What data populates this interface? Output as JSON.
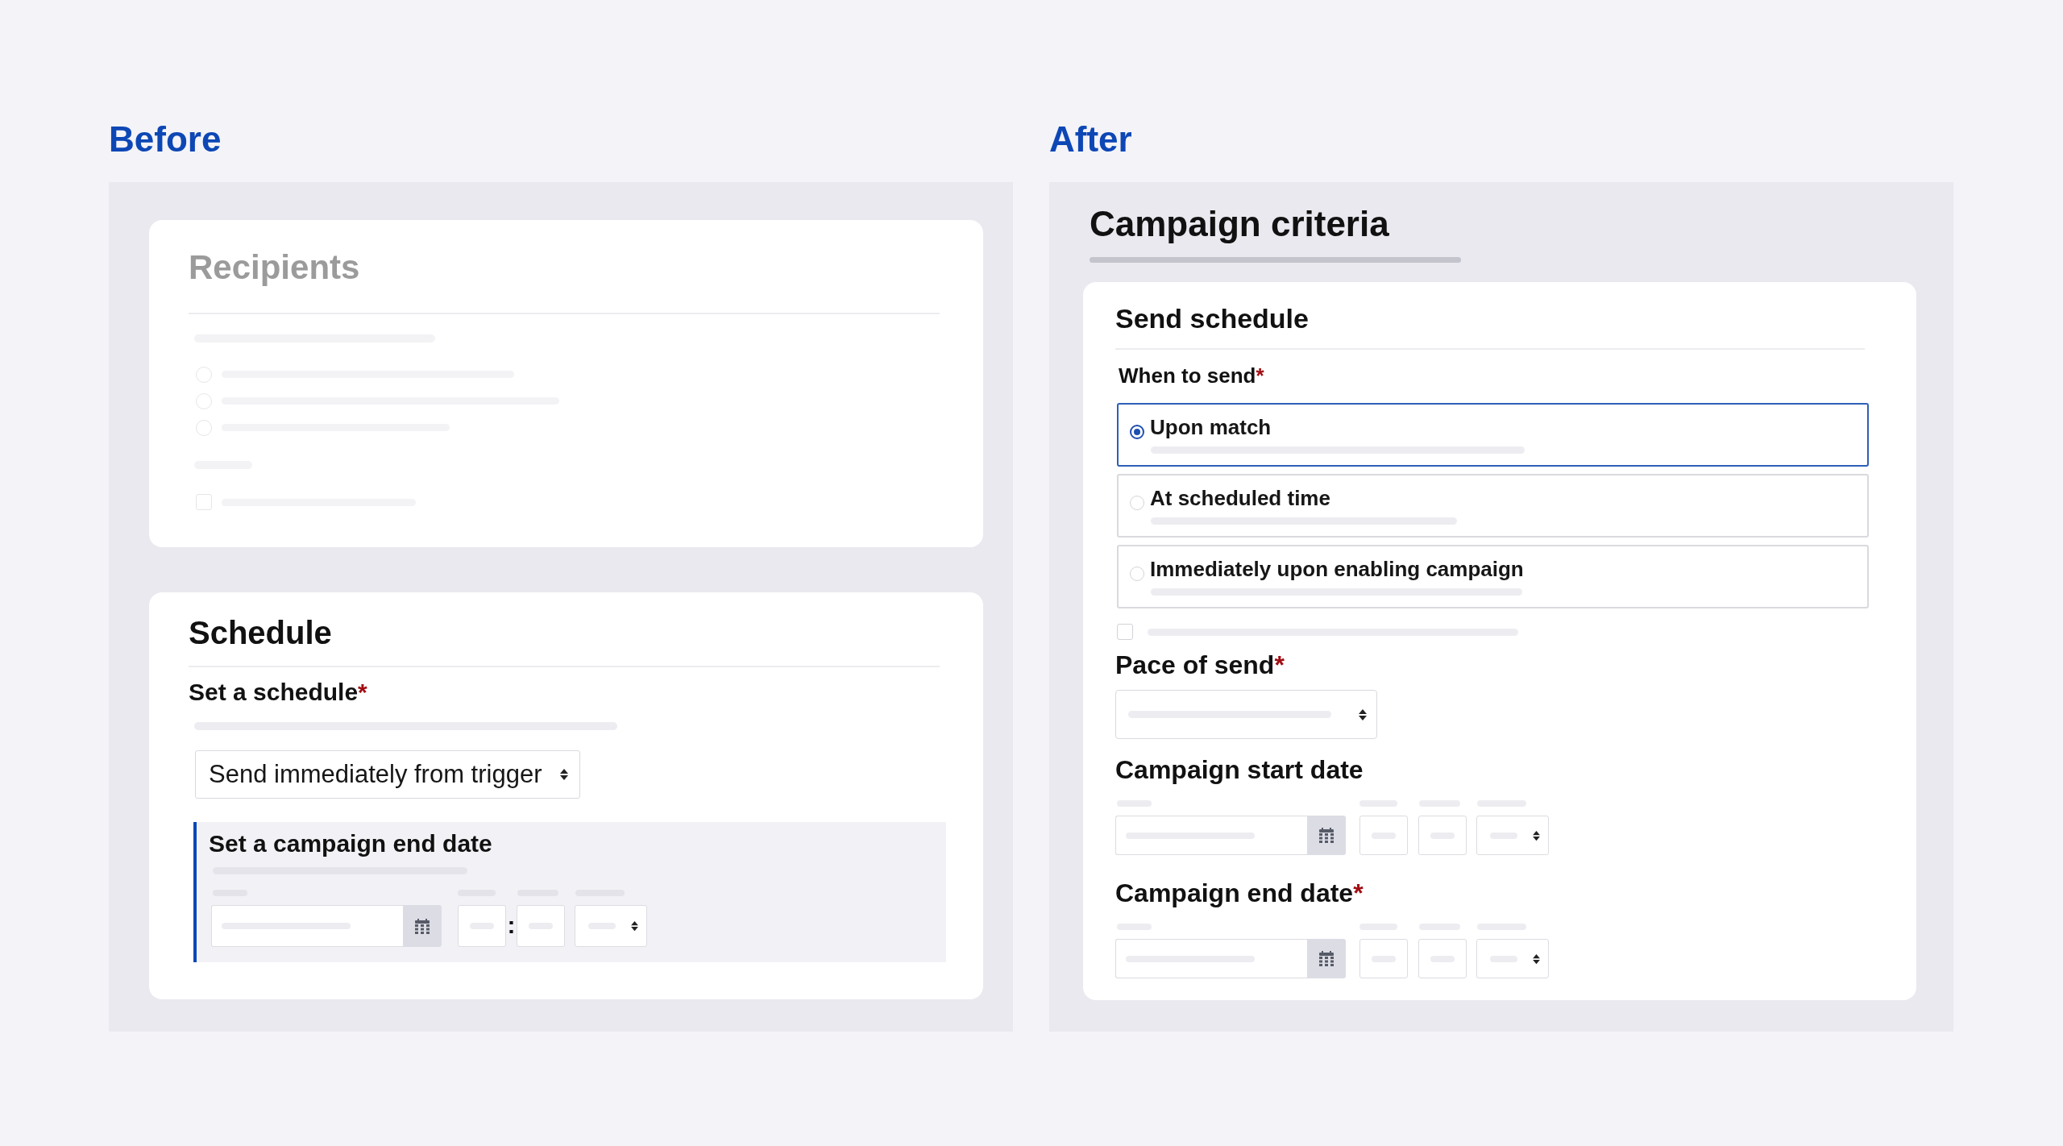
{
  "before": {
    "heading": "Before",
    "recipients": {
      "title": "Recipients",
      "rows": [
        {
          "kind": "radio"
        },
        {
          "kind": "radio"
        },
        {
          "kind": "radio"
        },
        {
          "kind": "caption"
        },
        {
          "kind": "checkbox",
          "checked": false
        }
      ]
    },
    "schedule": {
      "title": "Schedule",
      "field_label": "Set a schedule",
      "required_mark": "*",
      "select_value": "Send immediately from trigger",
      "end_date": {
        "title": "Set a campaign end date",
        "time_separator": ":"
      }
    }
  },
  "after": {
    "heading": "After",
    "title": "Campaign criteria",
    "send_schedule": {
      "title": "Send schedule",
      "when_to_send": {
        "label": "When to send",
        "required_mark": "*",
        "options": [
          {
            "label": "Upon match",
            "selected": true
          },
          {
            "label": "At scheduled time",
            "selected": false
          },
          {
            "label": "Immediately upon enabling campaign",
            "selected": false
          }
        ]
      },
      "checkbox": {
        "checked": false
      },
      "pace_of_send": {
        "label": "Pace of send",
        "required_mark": "*"
      },
      "start_date": {
        "label": "Campaign start date"
      },
      "end_date": {
        "label": "Campaign end date",
        "required_mark": "*"
      }
    }
  }
}
